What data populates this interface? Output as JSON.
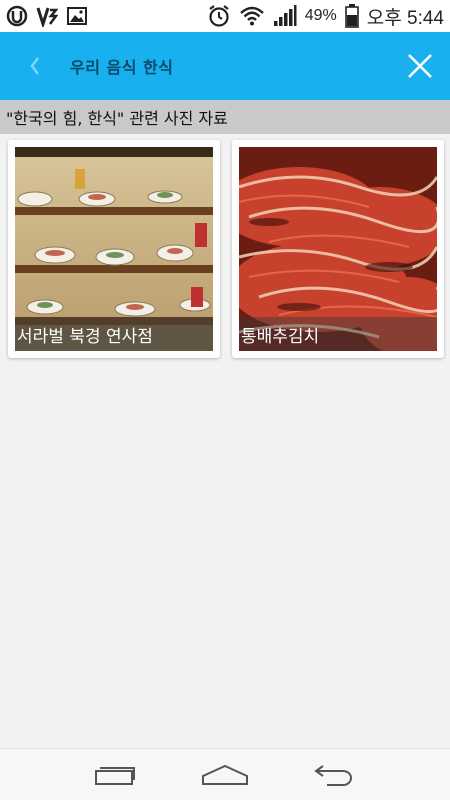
{
  "status_bar": {
    "battery_percent": "49%",
    "time": "오후 5:44"
  },
  "app_bar": {
    "title": "우리 음식 한식"
  },
  "section": {
    "header": "\"한국의 힘, 한식\" 관련 사진 자료"
  },
  "photos": [
    {
      "caption": "서라벌 북경 연사점"
    },
    {
      "caption": "통배추김치"
    }
  ],
  "colors": {
    "app_bar": "#18b0ef",
    "section_header": "#c9c9c9",
    "background": "#f2f2f2"
  }
}
